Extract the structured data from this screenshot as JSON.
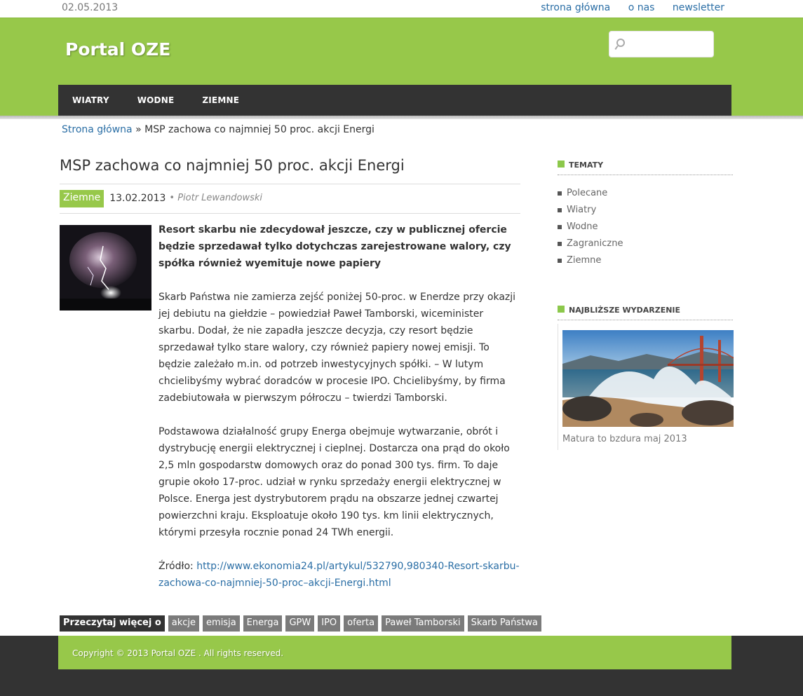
{
  "topbar": {
    "date": "02.05.2013",
    "links": [
      "strona główna",
      "o nas",
      "newsletter"
    ]
  },
  "header": {
    "site_title": "Portal OZE",
    "search_placeholder": ""
  },
  "nav": {
    "items": [
      "WIATRY",
      "WODNE",
      "ZIEMNE"
    ]
  },
  "breadcrumb": {
    "home": "Strona główna",
    "separator": "»",
    "current": "MSP zachowa co najmniej 50 proc. akcji Energi"
  },
  "article": {
    "title": "MSP zachowa co najmniej 50 proc. akcji Energi",
    "category": "Ziemne",
    "date": "13.02.2013",
    "author": "• Piotr Lewandowski",
    "lead": "Resort skarbu nie zdecydował jeszcze, czy w publicznej ofercie będzie sprzedawał tylko dotychczas zarejestrowane walory, czy spółka również wyemituje nowe papiery",
    "paragraph1": "Skarb Państwa nie zamierza zejść poniżej 50-proc. w Enerdze przy okazji jej debiutu na giełdzie – powiedział Paweł Tamborski, wiceminister skarbu. Dodał, że nie zapadła jeszcze decyzja, czy resort będzie sprzedawał tylko stare walory, czy również papiery nowej emisji. To będzie zależało m.in. od potrzeb inwestycyjnych spółki. – W lutym chcielibyśmy wybrać doradców w procesie IPO. Chcielibyśmy, by firma zadebiutowała w pierwszym półroczu – twierdzi Tamborski.",
    "paragraph2": "Podstawowa działalność grupy Energa obejmuje wytwarzanie, obrót i dystrybucję energii elektrycznej i cieplnej. Dostarcza ona prąd do około 2,5 mln gospodarstw domowych oraz do ponad 300 tys. firm. To daje grupie około 17-proc. udział w rynku sprzedaży energii elektrycznej w Polsce. Energa jest dystrybutorem prądu na obszarze jednej czwartej powierzchni kraju. Eksploatuje około 190 tys. km linii elektrycznych, którymi przesyła rocznie ponad 24 TWh energii.",
    "source_label": "Źródło:",
    "source_url": "http://www.ekonomia24.pl/artykul/532790,980340-Resort-skarbu-zachowa-co-najmniej-50-proc–akcji-Energi.html"
  },
  "tags": {
    "heading": "Przeczytaj więcej o",
    "items": [
      "akcje",
      "emisja",
      "Energa",
      "GPW",
      "IPO",
      "oferta",
      "Paweł Tamborski",
      "Skarb Państwa"
    ]
  },
  "sidebar": {
    "topics_title": "TEMATY",
    "topics": [
      "Polecane",
      "Wiatry",
      "Wodne",
      "Zagraniczne",
      "Ziemne"
    ],
    "event_title": "NAJBLIŻSZE WYDARZENIE",
    "event_caption": "Matura to bzdura maj 2013"
  },
  "footer": {
    "copyright": "Copyright © 2013 Portal OZE . All rights reserved."
  }
}
